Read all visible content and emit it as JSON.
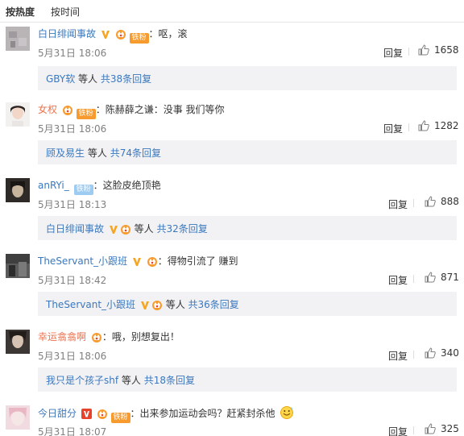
{
  "sort_tabs": {
    "hot": "按热度",
    "time": "按时间"
  },
  "comments": [
    {
      "user": "白日绯闻事故",
      "text": "呕，滚",
      "time": "5月31日 18:06",
      "reply": "回复",
      "likes": "1658",
      "badge": "铁粉",
      "summary": {
        "user": "GBY软",
        "mid": "等人",
        "count": "共38条回复"
      }
    },
    {
      "user": "女权",
      "text": "陈赫薛之谦：没事 我们等你",
      "time": "5月31日 18:06",
      "reply": "回复",
      "likes": "1282",
      "badge": "铁粉",
      "summary": {
        "user": "顾及易生",
        "mid": "等人",
        "count": "共74条回复"
      }
    },
    {
      "user": "anRYi_",
      "text": "这脸皮绝顶艳",
      "time": "5月31日 18:13",
      "reply": "回复",
      "likes": "888",
      "badge": "铁粉",
      "summary": {
        "user": "白日绯闻事故",
        "mid": "等人",
        "count": "共32条回复"
      }
    },
    {
      "user": "TheServant_小跟班",
      "text": "得物引流了 赚到",
      "time": "5月31日 18:42",
      "reply": "回复",
      "likes": "871",
      "summary": {
        "user": "TheServant_小跟班",
        "mid": "等人",
        "count": "共36条回复"
      }
    },
    {
      "user": "幸运翕翕啊",
      "text": "哦，别想复出！",
      "time": "5月31日 18:06",
      "reply": "回复",
      "likes": "340",
      "summary": {
        "user": "我只是个孩子shf",
        "mid": "等人",
        "count": "共18条回复"
      }
    },
    {
      "user": "今日甜分",
      "text": "出来参加运动会吗？赶紧封杀他",
      "time": "5月31日 18:07",
      "reply": "回复",
      "likes": "325",
      "badge": "铁粉"
    }
  ],
  "colors": {
    "orange_name": "#eb7350",
    "link_blue": "#3b78bd",
    "box_bg": "#f2f2f5",
    "vip_gold": "#f5a623"
  }
}
